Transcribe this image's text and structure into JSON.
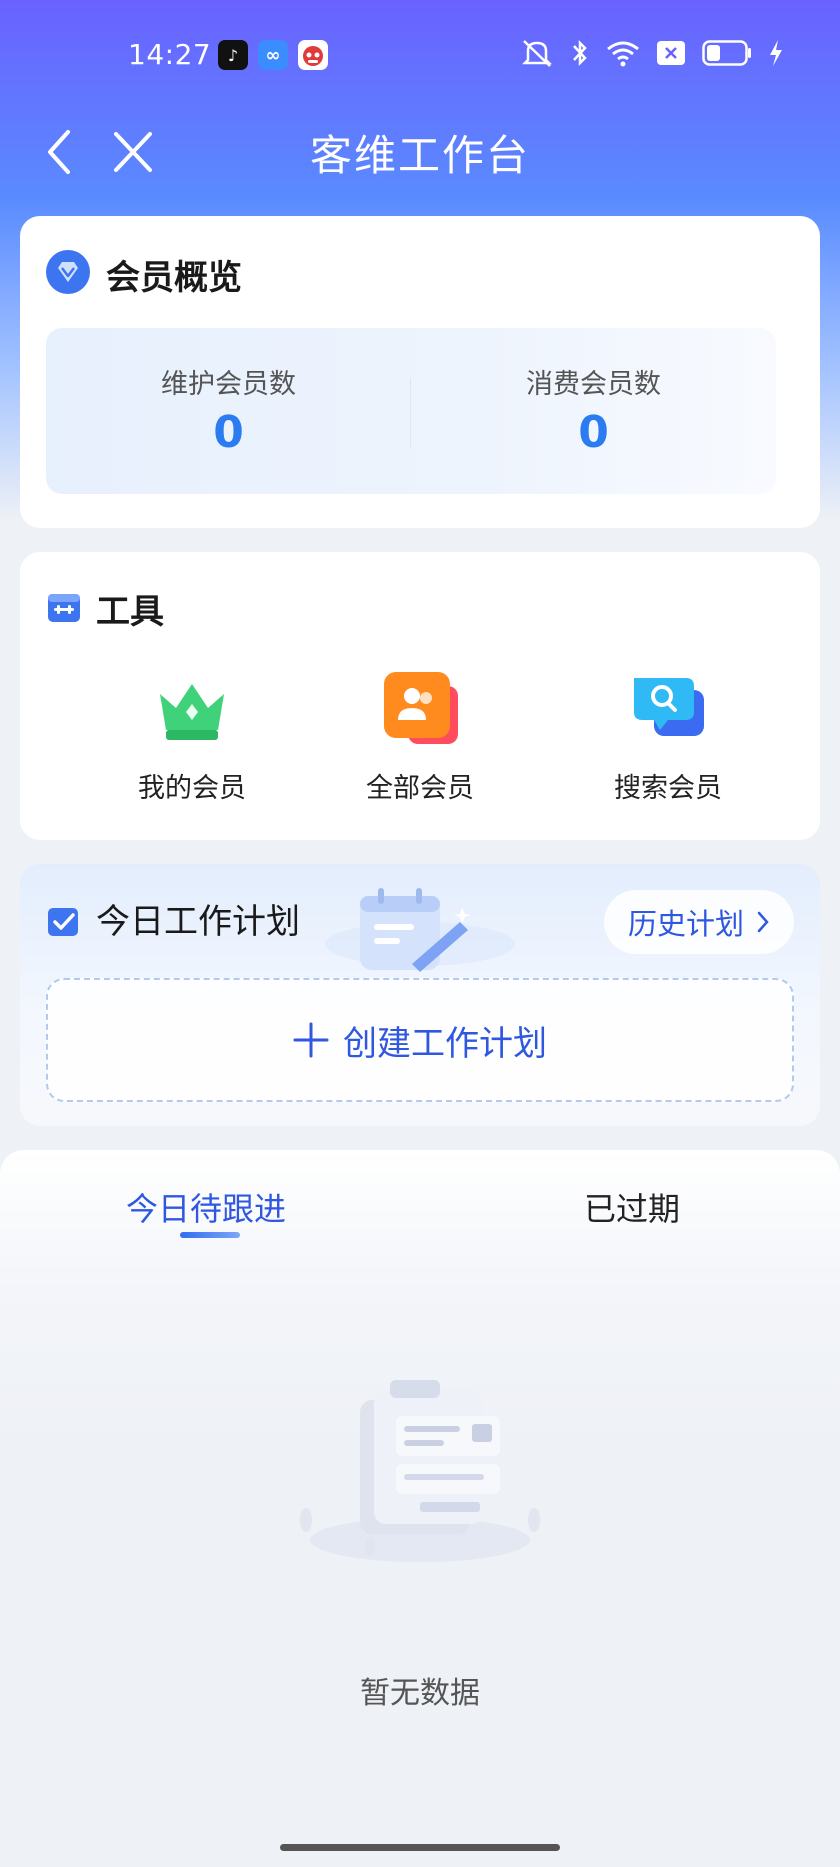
{
  "status_bar": {
    "time": "14:27",
    "apps": [
      "douyin-icon",
      "infinity-icon",
      "mascot-icon"
    ],
    "right_icons": [
      "silent-icon",
      "bluetooth-icon",
      "wifi-icon",
      "sim-off-icon",
      "battery-icon",
      "charging-icon"
    ],
    "battery_level": 0.3
  },
  "nav": {
    "title": "客维工作台",
    "back_icon": "back-icon",
    "close_icon": "close-icon"
  },
  "overview": {
    "title": "会员概览",
    "icon": "diamond-icon",
    "stats": [
      {
        "label": "维护会员数",
        "value": "0"
      },
      {
        "label": "消费会员数",
        "value": "0"
      }
    ]
  },
  "tools": {
    "title": "工具",
    "icon": "toolbox-icon",
    "items": [
      {
        "label": "我的会员",
        "icon": "crown-icon"
      },
      {
        "label": "全部会员",
        "icon": "members-icon"
      },
      {
        "label": "搜索会员",
        "icon": "search-member-icon"
      }
    ]
  },
  "plan": {
    "title": "今日工作计划",
    "history_label": "历史计划",
    "create_label": "创建工作计划"
  },
  "tasks": {
    "tabs": [
      {
        "label": "今日待跟进",
        "active": true
      },
      {
        "label": "已过期",
        "active": false
      }
    ],
    "empty_text": "暂无数据"
  },
  "colors": {
    "accent": "#2f57e0",
    "value_blue": "#2b7cf0",
    "header_start": "#6a62ff",
    "header_end": "#5a8bff"
  }
}
